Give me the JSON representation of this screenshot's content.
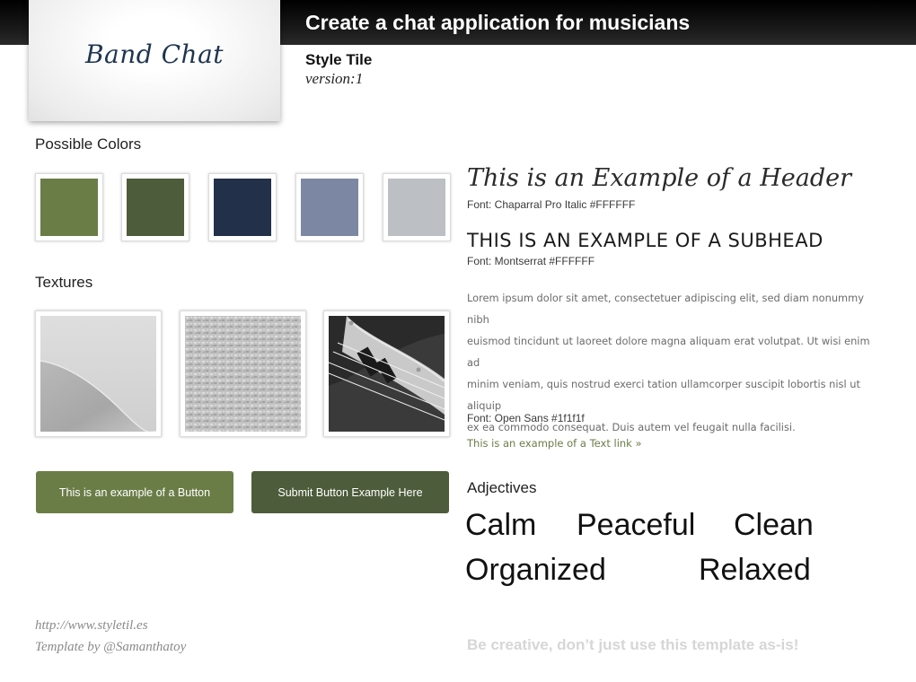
{
  "header": {
    "title": "Create a chat application for musicians",
    "logo_text": "Band Chat",
    "subtitle": "Style Tile",
    "version": "version:1"
  },
  "colors": {
    "heading": "Possible Colors",
    "swatches": [
      {
        "name": "green",
        "hex": "#6b7d47"
      },
      {
        "name": "dark-green",
        "hex": "#4d5c3a"
      },
      {
        "name": "navy",
        "hex": "#23304a"
      },
      {
        "name": "slate-blue",
        "hex": "#7c87a3"
      },
      {
        "name": "light-gray",
        "hex": "#bcbfc3"
      }
    ]
  },
  "textures": {
    "heading": "Textures",
    "items": [
      {
        "name": "sand-dune-texture"
      },
      {
        "name": "gravel-texture"
      },
      {
        "name": "bass-guitar-texture"
      }
    ]
  },
  "buttons": {
    "primary_label": "This is an example of a Button",
    "primary_color": "#6b7d47",
    "submit_label": "Submit Button Example Here",
    "submit_color": "#4d5c3a"
  },
  "typography": {
    "header_example": "This is an Example of a Header",
    "header_font": "Font: Chaparral Pro Italic #FFFFFF",
    "subhead_example": "THIS IS AN EXAMPLE OF A SUBHEAD",
    "subhead_font": "Font: Montserrat #FFFFFF",
    "body_lines": [
      "Lorem ipsum dolor sit amet, consectetuer adipiscing elit, sed diam nonummy nibh",
      "euismod tincidunt ut laoreet dolore magna aliquam erat volutpat. Ut wisi enim ad",
      "minim veniam, quis nostrud exerci tation ullamcorper suscipit lobortis nisl ut aliquip",
      "ex ea commodo consequat. Duis autem vel feugait nulla facilisi."
    ],
    "body_font": "Font: Open Sans #1f1f1f",
    "link_text": "This is an example of a Text link »",
    "link_color": "#6b7d47"
  },
  "adjectives": {
    "heading": "Adjectives",
    "words": [
      "Calm",
      "Peaceful",
      "Clean",
      "Organized",
      "Relaxed"
    ]
  },
  "footer": {
    "url": "http://www.styletil.es",
    "credit": "Template by @Samanthatoy",
    "tagline": "Be creative, don’t just use this template as-is!"
  }
}
